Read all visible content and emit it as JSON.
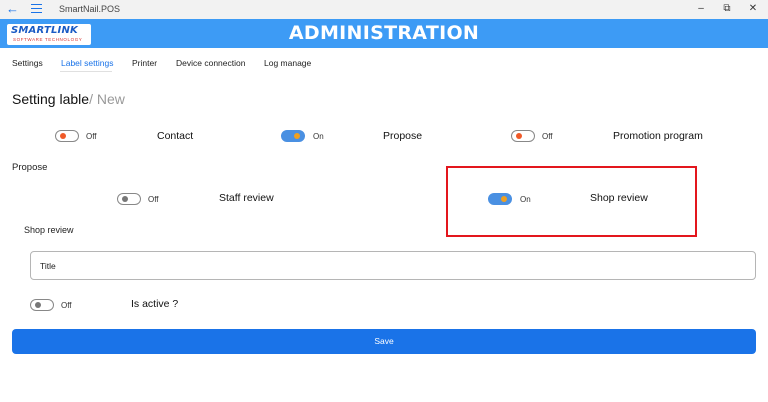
{
  "window": {
    "title": "SmartNail.POS"
  },
  "header": {
    "logo_text": "SMARTLINK",
    "logo_sub": "SOFTWARE TECHNOLOGY",
    "title": "ADMINISTRATION"
  },
  "tabs": [
    {
      "label": "Settings",
      "active": false
    },
    {
      "label": "Label settings",
      "active": true
    },
    {
      "label": "Printer",
      "active": false
    },
    {
      "label": "Device connection",
      "active": false
    },
    {
      "label": "Log manage",
      "active": false
    }
  ],
  "page": {
    "heading_main": "Setting lable",
    "heading_sub": "/ New"
  },
  "row1": [
    {
      "state": "Off",
      "on": false,
      "label": "Contact"
    },
    {
      "state": "On",
      "on": true,
      "label": "Propose"
    },
    {
      "state": "Off",
      "on": false,
      "label": "Promotion program"
    }
  ],
  "propose_section": {
    "label": "Propose",
    "items": [
      {
        "state": "Off",
        "on": false,
        "label": "Staff review"
      },
      {
        "state": "On",
        "on": true,
        "label": "Shop review"
      }
    ]
  },
  "shop_review_section": {
    "label": "Shop review",
    "title_input_value": "Title",
    "active_toggle": {
      "state": "Off",
      "on": false,
      "label": "Is active ?"
    }
  },
  "save_label": "Save",
  "colors": {
    "header_bg": "#3d9bf5",
    "accent": "#1a73e8",
    "highlight": "#e3161d",
    "toggle_on": "#4a90e2",
    "knob_off": "#f05a28",
    "knob_on": "#f0a020"
  }
}
